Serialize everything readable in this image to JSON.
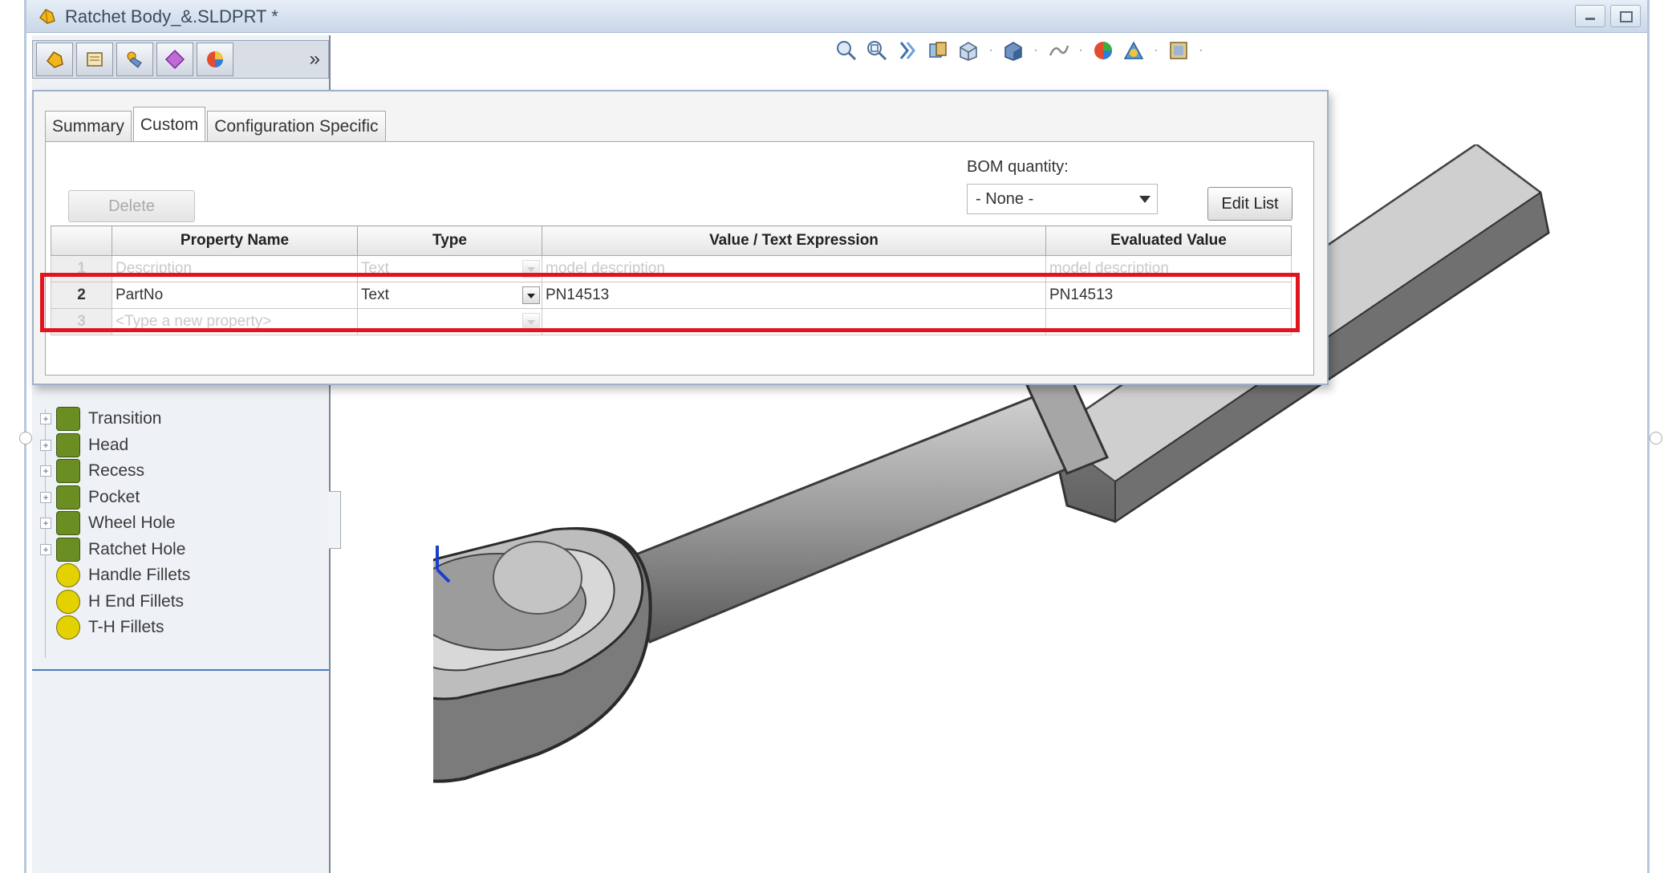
{
  "window": {
    "title": "Ratchet Body_&.SLDPRT *"
  },
  "featuremanager": {
    "tab_icons": [
      "featuremanager-tree-icon",
      "property-manager-icon",
      "configuration-manager-icon",
      "dimxpert-icon",
      "display-manager-icon"
    ],
    "more_label": "»",
    "items": [
      {
        "label": "Transition",
        "type": "feature",
        "expandable": true
      },
      {
        "label": "Head",
        "type": "feature",
        "expandable": true
      },
      {
        "label": "Recess",
        "type": "feature",
        "expandable": true
      },
      {
        "label": "Pocket",
        "type": "feature",
        "expandable": true
      },
      {
        "label": "Wheel Hole",
        "type": "feature",
        "expandable": true
      },
      {
        "label": "Ratchet Hole",
        "type": "feature",
        "expandable": true
      },
      {
        "label": "Handle Fillets",
        "type": "fillet",
        "expandable": false
      },
      {
        "label": "H End Fillets",
        "type": "fillet",
        "expandable": false
      },
      {
        "label": "T-H Fillets",
        "type": "fillet",
        "expandable": false
      }
    ]
  },
  "view_toolbar": {
    "icons": [
      "zoom-to-fit-icon",
      "zoom-to-area-icon",
      "previous-view-icon",
      "section-view-icon",
      "view-orientation-icon",
      "display-style-icon",
      "hide-show-items-icon",
      "edit-appearance-icon",
      "apply-scene-icon",
      "view-settings-icon"
    ]
  },
  "dialog": {
    "tabs": [
      "Summary",
      "Custom",
      "Configuration Specific"
    ],
    "active_tab": "Custom",
    "delete_label": "Delete",
    "bom_label": "BOM quantity:",
    "bom_value": "- None -",
    "edit_list_label": "Edit List",
    "columns": [
      "",
      "Property Name",
      "Type",
      "Value / Text Expression",
      "Evaluated Value"
    ],
    "rows": [
      {
        "num": "1",
        "name": "Description",
        "type": "Text",
        "value": "model description",
        "evaluated": "model description",
        "faded": true
      },
      {
        "num": "2",
        "name": "PartNo",
        "type": "Text",
        "value": "PN14513",
        "evaluated": "PN14513",
        "faded": false
      },
      {
        "num": "3",
        "name": "<Type a new property>",
        "type": "",
        "value": "",
        "evaluated": "",
        "faded": true
      }
    ]
  },
  "colors": {
    "highlight": "#e2141e",
    "feature_icon": "#6b8e23",
    "fillet_icon": "#e3d200"
  }
}
